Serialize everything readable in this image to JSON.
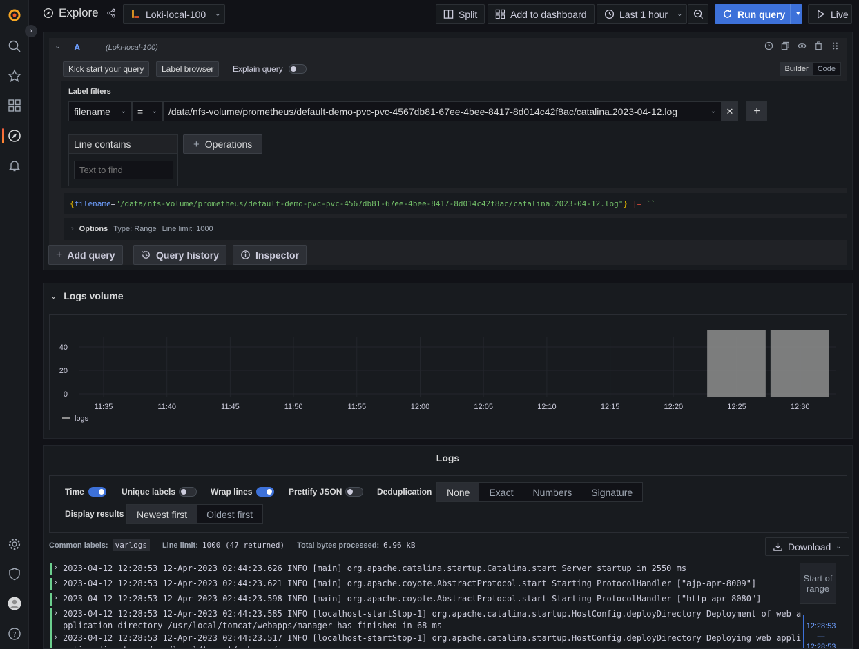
{
  "topbar": {
    "title": "Explore",
    "datasource": "Loki-local-100",
    "split": "Split",
    "add_to_dashboard": "Add to dashboard",
    "time_range": "Last 1 hour",
    "run_query": "Run query",
    "live": "Live"
  },
  "query": {
    "ref_id": "A",
    "datasource_label": "(Loki-local-100)",
    "kick_start": "Kick start your query",
    "label_browser": "Label browser",
    "explain_query": "Explain query",
    "mode_builder": "Builder",
    "mode_code": "Code",
    "label_filters_title": "Label filters",
    "filter_label": "filename",
    "filter_op": "=",
    "filter_value": "/data/nfs-volume/prometheus/default-demo-pvc-pvc-4567db81-67ee-4bee-8417-8d014c42f8ac/catalina.2023-04-12.log",
    "line_contains": "Line contains",
    "text_placeholder": "Text to find",
    "operations": "Operations",
    "preview_open": "{",
    "preview_key": "filename",
    "preview_eq": "=",
    "preview_val": "\"/data/nfs-volume/prometheus/default-demo-pvc-pvc-4567db81-67ee-4bee-8417-8d014c42f8ac/catalina.2023-04-12.log\"",
    "preview_close": "}",
    "preview_pipe": "|=",
    "preview_tail": "``",
    "options": "Options",
    "options_type": "Type: Range",
    "options_limit": "Line limit: 1000"
  },
  "actions": {
    "add_query": "Add query",
    "query_history": "Query history",
    "inspector": "Inspector"
  },
  "volume": {
    "title": "Logs volume",
    "legend": "logs",
    "colors": {
      "series": "#8e8e8e"
    }
  },
  "chart_data": {
    "type": "bar",
    "title": "Logs volume",
    "x": [
      "11:35",
      "11:40",
      "11:45",
      "11:50",
      "11:55",
      "12:00",
      "12:05",
      "12:10",
      "12:15",
      "12:20",
      "12:25",
      "12:30"
    ],
    "y_ticks": [
      "0",
      "20",
      "40"
    ],
    "ylim": [
      0,
      47
    ],
    "series": [
      {
        "name": "logs",
        "values": [
          0,
          0,
          0,
          0,
          0,
          0,
          0,
          0,
          0,
          0,
          47,
          47
        ]
      }
    ],
    "grid": true,
    "legend": "bottom-left"
  },
  "logs": {
    "title": "Logs",
    "time": "Time",
    "unique_labels": "Unique labels",
    "wrap_lines": "Wrap lines",
    "prettify_json": "Prettify JSON",
    "deduplication": "Deduplication",
    "dedup_options": [
      "None",
      "Exact",
      "Numbers",
      "Signature"
    ],
    "display_results": "Display results",
    "order_options": [
      "Newest first",
      "Oldest first"
    ],
    "common_labels": "Common labels:",
    "common_labels_value": "varlogs",
    "line_limit": "Line limit:",
    "line_limit_value": "1000 (47 returned)",
    "total_bytes": "Total bytes processed:",
    "total_bytes_value": "6.96 kB",
    "download": "Download",
    "start_of_range": "Start of range",
    "nav_time_top": "12:28:53",
    "nav_dash": "—",
    "nav_time_bottom": "12:28:53",
    "lines": [
      "2023-04-12 12:28:53 12-Apr-2023 02:44:23.626 INFO [main] org.apache.catalina.startup.Catalina.start Server startup in 2550 ms",
      "2023-04-12 12:28:53 12-Apr-2023 02:44:23.621 INFO [main] org.apache.coyote.AbstractProtocol.start Starting ProtocolHandler [\"ajp-apr-8009\"]",
      "2023-04-12 12:28:53 12-Apr-2023 02:44:23.598 INFO [main] org.apache.coyote.AbstractProtocol.start Starting ProtocolHandler [\"http-apr-8080\"]",
      "2023-04-12 12:28:53 12-Apr-2023 02:44:23.585 INFO [localhost-startStop-1] org.apache.catalina.startup.HostConfig.deployDirectory Deployment of web a",
      "pplication directory /usr/local/tomcat/webapps/manager has finished in 68 ms",
      "2023-04-12 12:28:53 12-Apr-2023 02:44:23.517 INFO [localhost-startStop-1] org.apache.catalina.startup.HostConfig.deployDirectory Deploying web appli",
      "cation directory /usr/local/tomcat/webapps/manager"
    ]
  }
}
